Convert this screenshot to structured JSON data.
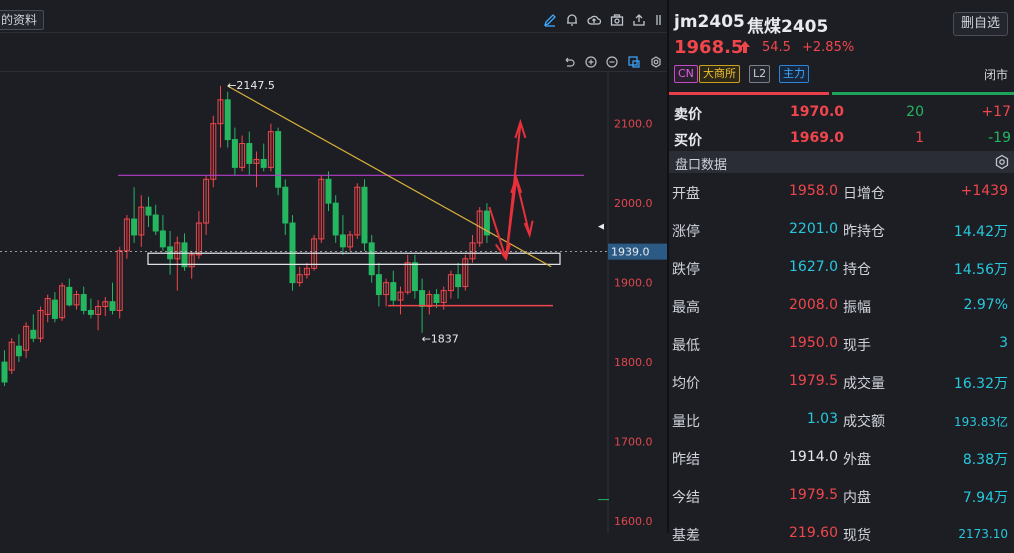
{
  "chart_toolbar": {
    "tab_label": "的资料",
    "icons": [
      "pencil-icon",
      "bell-icon",
      "cloud-icon",
      "camera-icon",
      "share-icon",
      "expand-icon"
    ]
  },
  "chart_toolbar2": {
    "icons": [
      "undo-icon",
      "zoom-in-icon",
      "zoom-out-icon",
      "layout-icon",
      "settings-icon"
    ]
  },
  "chart_data": {
    "type": "candlestick",
    "y_ticks": [
      "2100.0",
      "2000.0",
      "1900.0",
      "1800.0",
      "1700.0",
      "1600.0"
    ],
    "ylim": [
      1585,
      2165
    ],
    "current_price_label": "1939.0",
    "current_price": 1939.0,
    "annotations": {
      "high_label": "←2147.5",
      "high_value": 2147.5,
      "low_label": "←1837",
      "low_value": 1837
    },
    "lines": {
      "resistance_level": 2035,
      "support_level": 1871,
      "box_low": 1923,
      "box_high": 1937,
      "trendline_start": [
        32,
        2147.5
      ],
      "trendline_end": [
        76,
        1920
      ]
    },
    "candles": [
      {
        "o": 1800,
        "h": 1815,
        "l": 1770,
        "c": 1775
      },
      {
        "o": 1790,
        "h": 1830,
        "l": 1785,
        "c": 1825
      },
      {
        "o": 1820,
        "h": 1835,
        "l": 1800,
        "c": 1808
      },
      {
        "o": 1815,
        "h": 1850,
        "l": 1805,
        "c": 1845
      },
      {
        "o": 1840,
        "h": 1860,
        "l": 1825,
        "c": 1830
      },
      {
        "o": 1830,
        "h": 1870,
        "l": 1825,
        "c": 1865
      },
      {
        "o": 1860,
        "h": 1885,
        "l": 1850,
        "c": 1880
      },
      {
        "o": 1878,
        "h": 1888,
        "l": 1850,
        "c": 1855
      },
      {
        "o": 1856,
        "h": 1900,
        "l": 1852,
        "c": 1896
      },
      {
        "o": 1894,
        "h": 1905,
        "l": 1870,
        "c": 1872
      },
      {
        "o": 1872,
        "h": 1890,
        "l": 1866,
        "c": 1885
      },
      {
        "o": 1885,
        "h": 1895,
        "l": 1860,
        "c": 1865
      },
      {
        "o": 1865,
        "h": 1880,
        "l": 1855,
        "c": 1860
      },
      {
        "o": 1860,
        "h": 1878,
        "l": 1840,
        "c": 1870
      },
      {
        "o": 1870,
        "h": 1882,
        "l": 1858,
        "c": 1876
      },
      {
        "o": 1876,
        "h": 1900,
        "l": 1860,
        "c": 1865
      },
      {
        "o": 1865,
        "h": 1945,
        "l": 1855,
        "c": 1940
      },
      {
        "o": 1940,
        "h": 1985,
        "l": 1930,
        "c": 1980
      },
      {
        "o": 1980,
        "h": 2020,
        "l": 1950,
        "c": 1960
      },
      {
        "o": 1960,
        "h": 2010,
        "l": 1945,
        "c": 1995
      },
      {
        "o": 1995,
        "h": 2008,
        "l": 1970,
        "c": 1985
      },
      {
        "o": 1985,
        "h": 1998,
        "l": 1960,
        "c": 1965
      },
      {
        "o": 1965,
        "h": 1985,
        "l": 1940,
        "c": 1945
      },
      {
        "o": 1945,
        "h": 1965,
        "l": 1910,
        "c": 1930
      },
      {
        "o": 1930,
        "h": 1958,
        "l": 1890,
        "c": 1950
      },
      {
        "o": 1950,
        "h": 1962,
        "l": 1915,
        "c": 1920
      },
      {
        "o": 1920,
        "h": 1940,
        "l": 1905,
        "c": 1935
      },
      {
        "o": 1935,
        "h": 1990,
        "l": 1930,
        "c": 1975
      },
      {
        "o": 1975,
        "h": 2035,
        "l": 1960,
        "c": 2030
      },
      {
        "o": 2030,
        "h": 2110,
        "l": 2020,
        "c": 2100
      },
      {
        "o": 2100,
        "h": 2147.5,
        "l": 2070,
        "c": 2130
      },
      {
        "o": 2130,
        "h": 2140,
        "l": 2070,
        "c": 2080
      },
      {
        "o": 2080,
        "h": 2095,
        "l": 2035,
        "c": 2045
      },
      {
        "o": 2045,
        "h": 2085,
        "l": 2040,
        "c": 2075
      },
      {
        "o": 2075,
        "h": 2090,
        "l": 2035,
        "c": 2050
      },
      {
        "o": 2050,
        "h": 2065,
        "l": 2020,
        "c": 2055
      },
      {
        "o": 2055,
        "h": 2075,
        "l": 2040,
        "c": 2045
      },
      {
        "o": 2045,
        "h": 2100,
        "l": 2040,
        "c": 2090
      },
      {
        "o": 2090,
        "h": 2095,
        "l": 2010,
        "c": 2020
      },
      {
        "o": 2020,
        "h": 2030,
        "l": 1960,
        "c": 1975
      },
      {
        "o": 1975,
        "h": 1985,
        "l": 1890,
        "c": 1900
      },
      {
        "o": 1900,
        "h": 1920,
        "l": 1895,
        "c": 1910
      },
      {
        "o": 1910,
        "h": 1925,
        "l": 1905,
        "c": 1918
      },
      {
        "o": 1918,
        "h": 1960,
        "l": 1915,
        "c": 1955
      },
      {
        "o": 1955,
        "h": 2035,
        "l": 1950,
        "c": 2030
      },
      {
        "o": 2030,
        "h": 2040,
        "l": 1990,
        "c": 2000
      },
      {
        "o": 2000,
        "h": 2010,
        "l": 1950,
        "c": 1960
      },
      {
        "o": 1960,
        "h": 1985,
        "l": 1935,
        "c": 1945
      },
      {
        "o": 1945,
        "h": 1965,
        "l": 1940,
        "c": 1960
      },
      {
        "o": 1960,
        "h": 2025,
        "l": 1955,
        "c": 2020
      },
      {
        "o": 2020,
        "h": 2030,
        "l": 1940,
        "c": 1950
      },
      {
        "o": 1950,
        "h": 1960,
        "l": 1900,
        "c": 1910
      },
      {
        "o": 1910,
        "h": 1925,
        "l": 1870,
        "c": 1885
      },
      {
        "o": 1885,
        "h": 1905,
        "l": 1870,
        "c": 1900
      },
      {
        "o": 1900,
        "h": 1915,
        "l": 1870,
        "c": 1878
      },
      {
        "o": 1878,
        "h": 1895,
        "l": 1860,
        "c": 1888
      },
      {
        "o": 1888,
        "h": 1935,
        "l": 1885,
        "c": 1925
      },
      {
        "o": 1925,
        "h": 1935,
        "l": 1880,
        "c": 1890
      },
      {
        "o": 1890,
        "h": 1905,
        "l": 1837,
        "c": 1870
      },
      {
        "o": 1870,
        "h": 1890,
        "l": 1860,
        "c": 1885
      },
      {
        "o": 1885,
        "h": 1892,
        "l": 1868,
        "c": 1875
      },
      {
        "o": 1875,
        "h": 1895,
        "l": 1866,
        "c": 1890
      },
      {
        "o": 1890,
        "h": 1915,
        "l": 1880,
        "c": 1910
      },
      {
        "o": 1910,
        "h": 1925,
        "l": 1880,
        "c": 1895
      },
      {
        "o": 1895,
        "h": 1935,
        "l": 1890,
        "c": 1930
      },
      {
        "o": 1930,
        "h": 1960,
        "l": 1925,
        "c": 1950
      },
      {
        "o": 1950,
        "h": 1995,
        "l": 1945,
        "c": 1990
      },
      {
        "o": 1990,
        "h": 2000,
        "l": 1950,
        "c": 1960
      }
    ],
    "colors": {
      "up": "#f0464b",
      "down": "#25b660"
    }
  },
  "quote": {
    "symbol": "jm2405",
    "name": "焦煤2405",
    "remove_watch_label": "删自选",
    "last_price": "1968.5",
    "change": "54.5",
    "change_pct": "+2.85%",
    "badges": [
      "CN",
      "大商所",
      "L2",
      "主力"
    ],
    "market_status": "闭市",
    "order_book": [
      {
        "label": "卖价",
        "price": "1970.0",
        "volume": "20",
        "delta": "+17"
      },
      {
        "label": "买价",
        "price": "1969.0",
        "volume": "1",
        "delta": "-19"
      }
    ],
    "section_title": "盘口数据",
    "rows": [
      {
        "l1": "开盘",
        "v1": "1958.0",
        "l2": "日增仓",
        "v2": "+1439"
      },
      {
        "l1": "涨停",
        "v1": "2201.0",
        "l2": "昨持仓",
        "v2": "14.42万"
      },
      {
        "l1": "跌停",
        "v1": "1627.0",
        "l2": "持仓",
        "v2": "14.56万"
      },
      {
        "l1": "最高",
        "v1": "2008.0",
        "l2": "振幅",
        "v2": "2.97%"
      },
      {
        "l1": "最低",
        "v1": "1950.0",
        "l2": "现手",
        "v2": "3"
      },
      {
        "l1": "均价",
        "v1": "1979.5",
        "l2": "成交量",
        "v2": "16.32万"
      },
      {
        "l1": "量比",
        "v1": "1.03",
        "l2": "成交额",
        "v2": "193.83亿"
      },
      {
        "l1": "昨结",
        "v1": "1914.0",
        "l2": "外盘",
        "v2": "8.38万"
      },
      {
        "l1": "今结",
        "v1": "1979.5",
        "l2": "内盘",
        "v2": "7.94万"
      },
      {
        "l1": "基差",
        "v1": "219.60",
        "l2": "现货",
        "v2": "2173.10"
      }
    ]
  }
}
